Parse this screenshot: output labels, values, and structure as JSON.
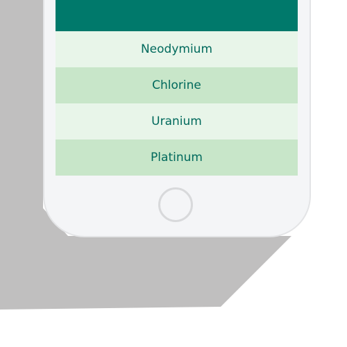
{
  "colors": {
    "header": "#00796b",
    "row_light": "#e8f5e9",
    "row_dark": "#c8e6c9",
    "row_text": "#00695c",
    "phone_body": "#f4f5f7",
    "shadow": "#c0bfbf"
  },
  "list": {
    "items": [
      {
        "label": "Neodymium"
      },
      {
        "label": "Chlorine"
      },
      {
        "label": "Uranium"
      },
      {
        "label": "Platinum"
      }
    ]
  },
  "device": {
    "home_button_icon": "home-button-circle"
  }
}
